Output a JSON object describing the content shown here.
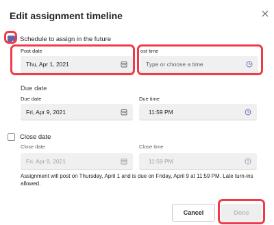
{
  "dialog": {
    "title": "Edit assignment timeline"
  },
  "schedule": {
    "label": "Schedule to assign in the future",
    "checked": true
  },
  "post": {
    "date_label": "Post date",
    "date_value": "Thu, Apr 1, 2021",
    "time_label": "ost time",
    "time_placeholder": "Type or choose a time"
  },
  "due": {
    "section_label": "Due date",
    "date_label": "Due date",
    "date_value": "Fri, Apr 9, 2021",
    "time_label": "Due time",
    "time_value": "11:59 PM"
  },
  "close": {
    "checkbox_label": "Close date",
    "checked": false,
    "date_label": "Close date",
    "date_value": "Fri, Apr 9, 2021",
    "time_label": "Close time",
    "time_value": "11:59 PM"
  },
  "info_text": "Assignment will post on Thursday, April 1 and is due on Friday, April 9 at 11:59 PM. Late turn-ins allowed.",
  "buttons": {
    "cancel": "Cancel",
    "done": "Done"
  },
  "colors": {
    "accent": "#6264a7",
    "highlight": "#ef3b47",
    "field_bg": "#f0f0f0"
  },
  "icons": [
    "close-icon",
    "calendar-icon",
    "clock-icon",
    "check-icon"
  ]
}
